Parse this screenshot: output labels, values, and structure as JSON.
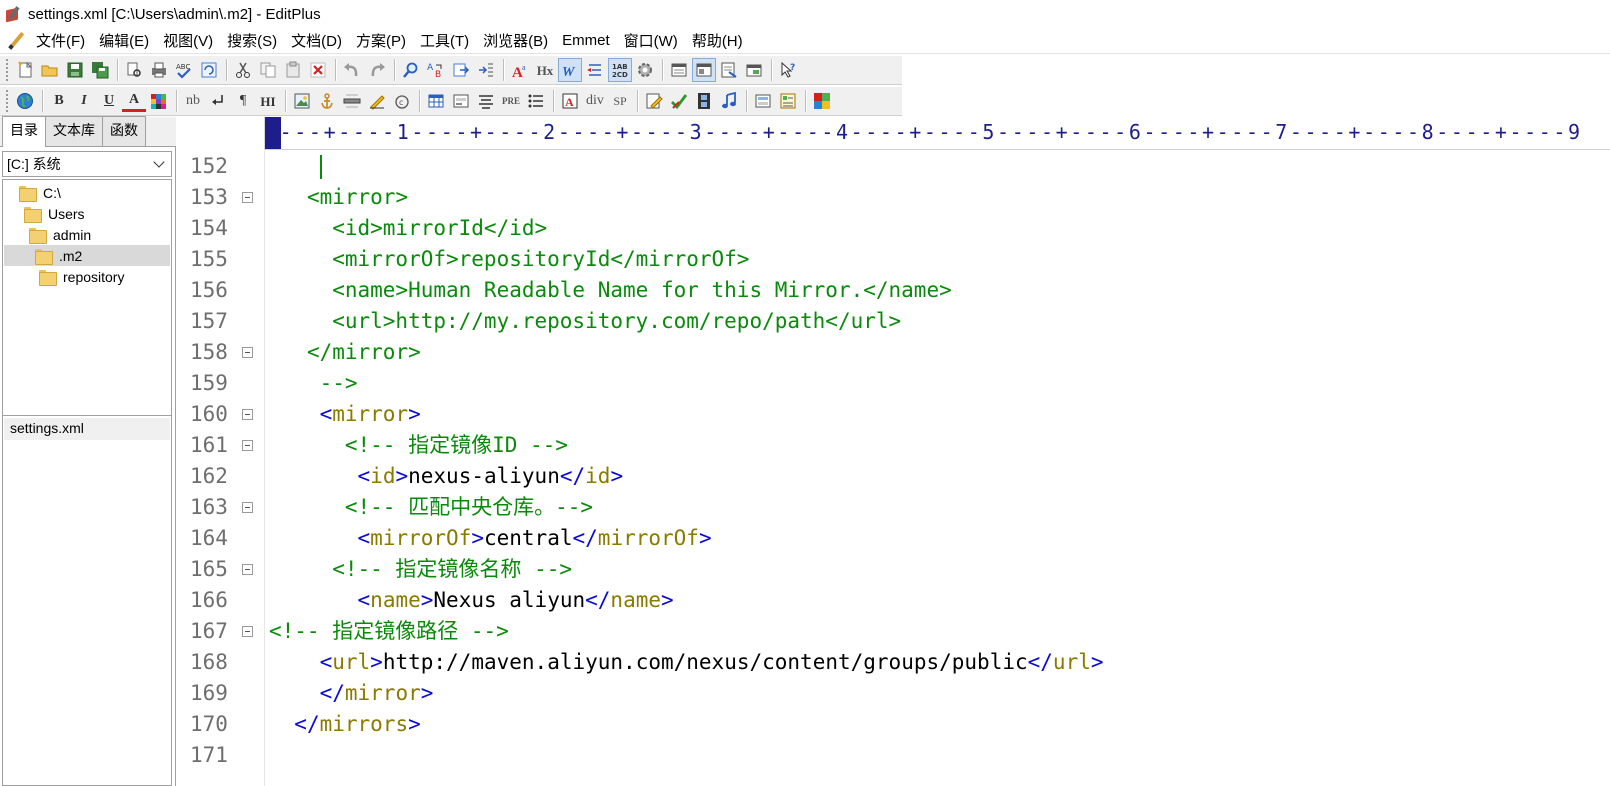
{
  "window": {
    "title": "settings.xml [C:\\Users\\admin\\.m2] - EditPlus"
  },
  "menubar": {
    "items": [
      "文件(F)",
      "编辑(E)",
      "视图(V)",
      "搜索(S)",
      "文档(D)",
      "方案(P)",
      "工具(T)",
      "浏览器(B)",
      "Emmet",
      "窗口(W)",
      "帮助(H)"
    ]
  },
  "toolbar2": {
    "bold": "B",
    "italic": "I",
    "underline": "U",
    "font_color": "A",
    "nbsp": "nb",
    "paragraph": "¶",
    "heading": "HI",
    "pre": "PRE",
    "div": "div",
    "sp": "SP",
    "hx": "Hx"
  },
  "sidebar": {
    "tabs": [
      "目录",
      "文本库",
      "函数"
    ],
    "drive": "[C:] 系统",
    "tree": [
      "C:\\",
      "Users",
      "admin",
      ".m2",
      "repository"
    ],
    "open_files": [
      "settings.xml"
    ]
  },
  "ruler": {
    "text": "----+----1----+----2----+----3----+----4----+----5----+----6----+----7----+----8----+----9"
  },
  "editor": {
    "lines": [
      {
        "num": "152",
        "indent": "    ",
        "fold": false,
        "parts": [],
        "caret": true
      },
      {
        "num": "153",
        "indent": "   ",
        "fold": true,
        "parts": [
          [
            "<mirror>",
            "g"
          ]
        ]
      },
      {
        "num": "154",
        "indent": "     ",
        "fold": false,
        "parts": [
          [
            "<id>mirrorId</id>",
            "g"
          ]
        ]
      },
      {
        "num": "155",
        "indent": "     ",
        "fold": false,
        "parts": [
          [
            "<mirrorOf>repositoryId</mirrorOf>",
            "g"
          ]
        ]
      },
      {
        "num": "156",
        "indent": "     ",
        "fold": false,
        "parts": [
          [
            "<name>Human Readable Name for this Mirror.</name>",
            "g"
          ]
        ]
      },
      {
        "num": "157",
        "indent": "     ",
        "fold": false,
        "parts": [
          [
            "<url>http://my.repository.com/repo/path</url>",
            "g"
          ]
        ]
      },
      {
        "num": "158",
        "indent": "   ",
        "fold": true,
        "parts": [
          [
            "</mirror>",
            "g"
          ]
        ]
      },
      {
        "num": "159",
        "indent": "    ",
        "fold": false,
        "parts": [
          [
            "-->",
            "g"
          ]
        ]
      },
      {
        "num": "160",
        "indent": "    ",
        "fold": true,
        "parts": [
          [
            "<",
            "b"
          ],
          [
            "mirror",
            "o"
          ],
          [
            ">",
            "b"
          ]
        ]
      },
      {
        "num": "161",
        "indent": "      ",
        "fold": true,
        "parts": [
          [
            "<!-- 指定镜像ID -->",
            "g"
          ]
        ]
      },
      {
        "num": "162",
        "indent": "       ",
        "fold": false,
        "parts": [
          [
            "<",
            "b"
          ],
          [
            "id",
            "o"
          ],
          [
            ">",
            "b"
          ],
          [
            "nexus-aliyun",
            "k"
          ],
          [
            "</",
            "b"
          ],
          [
            "id",
            "o"
          ],
          [
            ">",
            "b"
          ]
        ]
      },
      {
        "num": "163",
        "indent": "      ",
        "fold": true,
        "parts": [
          [
            "<!-- 匹配中央仓库。-->",
            "g"
          ]
        ]
      },
      {
        "num": "164",
        "indent": "       ",
        "fold": false,
        "parts": [
          [
            "<",
            "b"
          ],
          [
            "mirrorOf",
            "o"
          ],
          [
            ">",
            "b"
          ],
          [
            "central",
            "k"
          ],
          [
            "</",
            "b"
          ],
          [
            "mirrorOf",
            "o"
          ],
          [
            ">",
            "b"
          ]
        ]
      },
      {
        "num": "165",
        "indent": "     ",
        "fold": true,
        "parts": [
          [
            "<!-- 指定镜像名称 -->",
            "g"
          ]
        ]
      },
      {
        "num": "166",
        "indent": "       ",
        "fold": false,
        "parts": [
          [
            "<",
            "b"
          ],
          [
            "name",
            "o"
          ],
          [
            ">",
            "b"
          ],
          [
            "Nexus aliyun",
            "k"
          ],
          [
            "</",
            "b"
          ],
          [
            "name",
            "o"
          ],
          [
            ">",
            "b"
          ]
        ]
      },
      {
        "num": "167",
        "indent": "",
        "fold": true,
        "parts": [
          [
            "<!-- 指定镜像路径 -->",
            "g"
          ]
        ]
      },
      {
        "num": "168",
        "indent": "    ",
        "fold": false,
        "parts": [
          [
            "<",
            "b"
          ],
          [
            "url",
            "o"
          ],
          [
            ">",
            "b"
          ],
          [
            "http://maven.aliyun.com/nexus/content/groups/public",
            "k"
          ],
          [
            "</",
            "b"
          ],
          [
            "url",
            "o"
          ],
          [
            ">",
            "b"
          ]
        ]
      },
      {
        "num": "169",
        "indent": "    ",
        "fold": false,
        "parts": [
          [
            "</",
            "b"
          ],
          [
            "mirror",
            "o"
          ],
          [
            ">",
            "b"
          ]
        ]
      },
      {
        "num": "170",
        "indent": "  ",
        "fold": false,
        "parts": [
          [
            "</",
            "b"
          ],
          [
            "mirrors",
            "o"
          ],
          [
            ">",
            "b"
          ]
        ]
      },
      {
        "num": "171",
        "indent": "",
        "fold": false,
        "parts": []
      }
    ]
  },
  "colors": {
    "comment_green": "#0a8a0a",
    "tag_blue": "#0a0ad8",
    "tag_name_olive": "#8a7a00",
    "ruler_navy": "#1d1d8c"
  },
  "icons": {
    "toolbar1": [
      "new-file-icon",
      "open-folder-icon",
      "save-icon",
      "save-all-icon",
      "print-preview-icon",
      "print-icon",
      "spell-check-icon",
      "refresh-icon",
      "cut-icon",
      "copy-icon",
      "paste-icon",
      "delete-icon",
      "undo-icon",
      "redo-icon",
      "find-icon",
      "replace-icon",
      "goto-icon",
      "indent-icon",
      "font-icon",
      "hx-icon",
      "word-wrap-icon",
      "line-spacing-icon",
      "column-select-icon",
      "settings-gear-icon",
      "window-icon",
      "split-window-icon",
      "doc-window-icon",
      "restore-window-icon",
      "help-pointer-icon"
    ],
    "toolbar2": [
      "browser-globe-icon",
      "bold-icon",
      "italic-icon",
      "underline-icon",
      "font-color-icon",
      "color-palette-icon",
      "nbsp-icon",
      "line-break-icon",
      "paragraph-icon",
      "heading-icon",
      "image-icon",
      "anchor-icon",
      "hr-icon",
      "highlight-icon",
      "copyright-icon",
      "table-icon",
      "form-icon",
      "align-icon",
      "pre-icon",
      "list-icon",
      "text-box-icon",
      "div-icon",
      "span-icon",
      "edit-icon",
      "validate-icon",
      "film-icon",
      "music-icon",
      "panel-icon",
      "layout-icon",
      "color-grid-icon"
    ]
  }
}
